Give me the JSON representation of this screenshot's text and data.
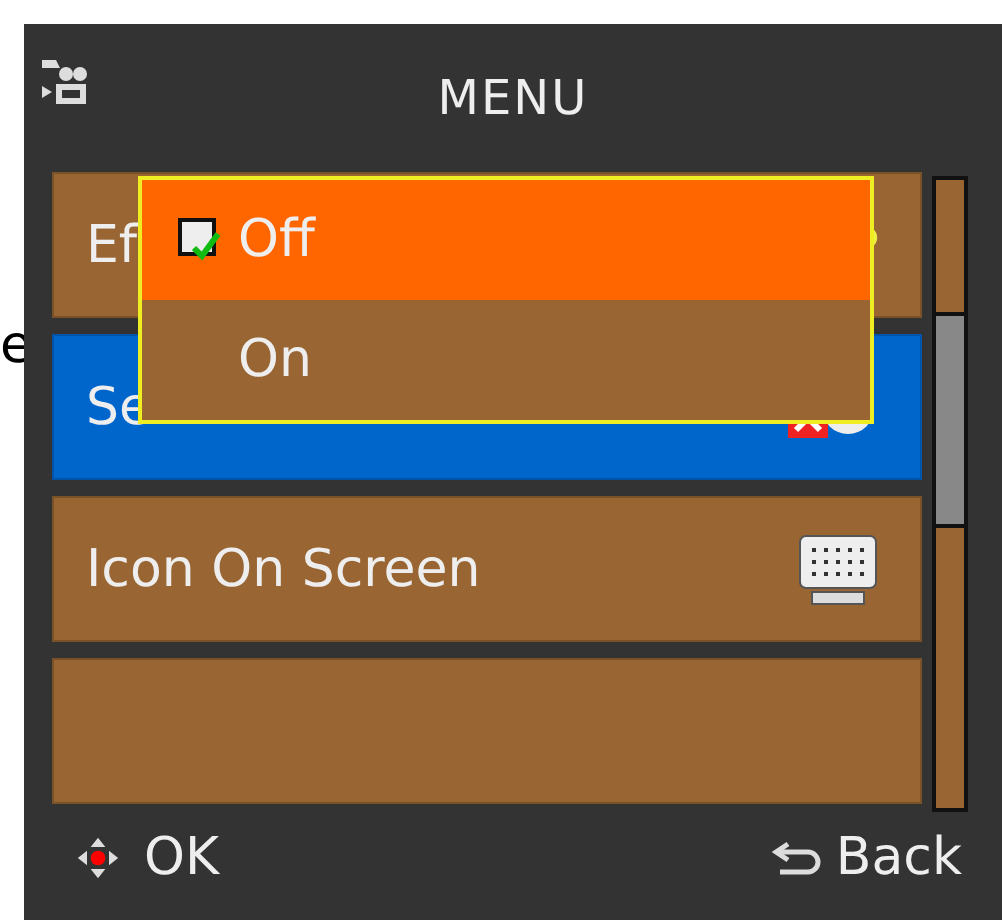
{
  "edge_text": "e",
  "header": {
    "title": "MENU"
  },
  "items": [
    {
      "kind": "label",
      "label": "Ef",
      "selected": false
    },
    {
      "kind": "label",
      "label": "Se",
      "selected": true
    },
    {
      "kind": "label",
      "label": "Icon On Screen",
      "selected": false
    },
    {
      "kind": "blank",
      "selected": false
    }
  ],
  "popup": {
    "options": [
      {
        "label": "Off",
        "selected": true,
        "checked": true
      },
      {
        "label": "On",
        "selected": false,
        "checked": false
      }
    ]
  },
  "footer": {
    "ok": "OK",
    "back": "Back"
  }
}
